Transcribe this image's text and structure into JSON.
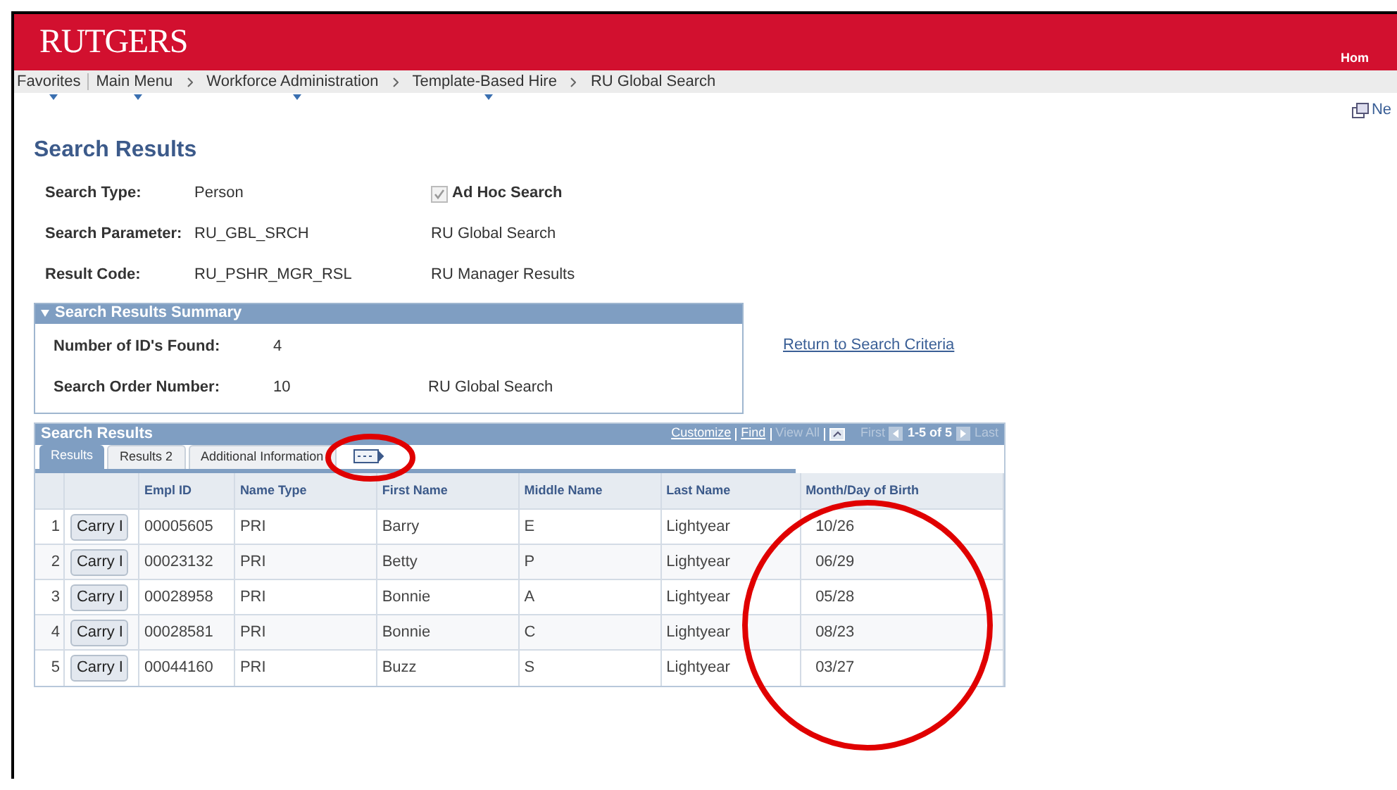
{
  "header": {
    "logo": "RUTGERS",
    "home_link": "Hom"
  },
  "breadcrumbs": [
    {
      "label": "Favorites",
      "menu": true
    },
    {
      "label": "Main Menu",
      "menu": true
    },
    {
      "label": "Workforce Administration",
      "menu": true
    },
    {
      "label": "Template-Based Hire",
      "menu": true
    },
    {
      "label": "RU Global Search",
      "menu": false
    }
  ],
  "new_window_link": "Ne",
  "page_title": "Search Results",
  "criteria": [
    {
      "label": "Search Type:",
      "value": "Person",
      "extra": "Ad Hoc Search",
      "kind": "checkbox",
      "checked": true,
      "disabled": true
    },
    {
      "label": "Search Parameter:",
      "value": "RU_GBL_SRCH",
      "extra": "RU Global Search",
      "kind": "text"
    },
    {
      "label": "Result Code:",
      "value": "RU_PSHR_MGR_RSL",
      "extra": "RU Manager Results",
      "kind": "text"
    }
  ],
  "summary": {
    "title": "Search Results Summary",
    "expanded": true,
    "fields": [
      {
        "label": "Number of ID's Found:",
        "value": "4"
      },
      {
        "label": "Search Order Number:",
        "value": "10",
        "extra": "RU Global Search"
      }
    ]
  },
  "return_link": "Return to Search Criteria",
  "grid": {
    "title": "Search Results",
    "nav": [
      {
        "label": "Customize",
        "disabled": false
      },
      {
        "label": "Find",
        "disabled": false
      },
      {
        "label": "View All",
        "disabled": true
      }
    ],
    "first": "First",
    "range": "1-5 of 5",
    "last": "Last",
    "tabs": [
      {
        "label": "Results",
        "selected": true
      },
      {
        "label": "Results 2",
        "selected": false
      },
      {
        "label": "Additional Information",
        "selected": false
      }
    ],
    "columns": [
      "Empl ID",
      "Name Type",
      "First Name",
      "Middle Name",
      "Last Name",
      "Month/Day of Birth"
    ],
    "rows": [
      {
        "num": "1",
        "button": "Carry I",
        "cells": [
          "00005605",
          "PRI",
          "Barry",
          "E",
          "Lightyear",
          "10/26"
        ]
      },
      {
        "num": "2",
        "button": "Carry I",
        "cells": [
          "00023132",
          "PRI",
          "Betty",
          "P",
          "Lightyear",
          "06/29"
        ]
      },
      {
        "num": "3",
        "button": "Carry I",
        "cells": [
          "00028958",
          "PRI",
          "Bonnie",
          "A",
          "Lightyear",
          "05/28"
        ]
      },
      {
        "num": "4",
        "button": "Carry I",
        "cells": [
          "00028581",
          "PRI",
          "Bonnie",
          "C",
          "Lightyear",
          "08/23"
        ]
      },
      {
        "num": "5",
        "button": "Carry I",
        "cells": [
          "00044160",
          "PRI",
          "Buzz",
          "S",
          "Lightyear",
          "03/27"
        ]
      }
    ]
  }
}
